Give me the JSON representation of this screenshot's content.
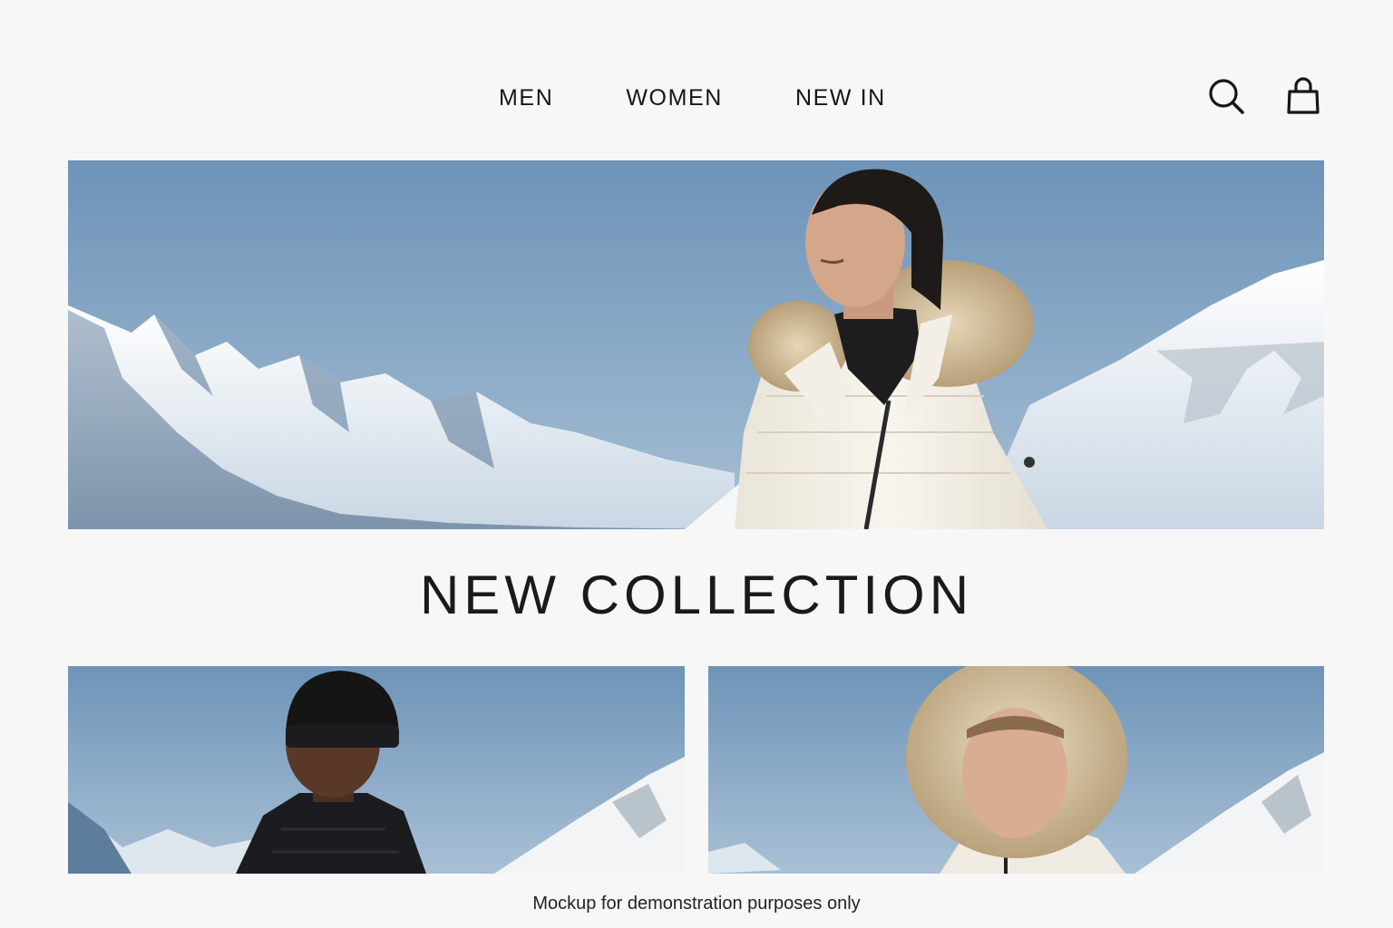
{
  "nav": {
    "items": [
      {
        "label": "MEN"
      },
      {
        "label": "WOMEN"
      },
      {
        "label": "NEW IN"
      }
    ],
    "search_icon": "search-icon",
    "bag_icon": "shopping-bag-icon"
  },
  "hero": {
    "alt": "Woman in a cream puffer jacket with fur hood in snowy mountains"
  },
  "section": {
    "title": "NEW COLLECTION"
  },
  "cards": [
    {
      "alt": "Man in black beanie and black puffer jacket"
    },
    {
      "alt": "Woman in cream jacket with fur-trimmed hood"
    }
  ],
  "footer": {
    "note": "Mockup for demonstration purposes only"
  },
  "colors": {
    "background": "#f7f7f7",
    "text": "#161616",
    "sky": "#7fa2c2"
  }
}
